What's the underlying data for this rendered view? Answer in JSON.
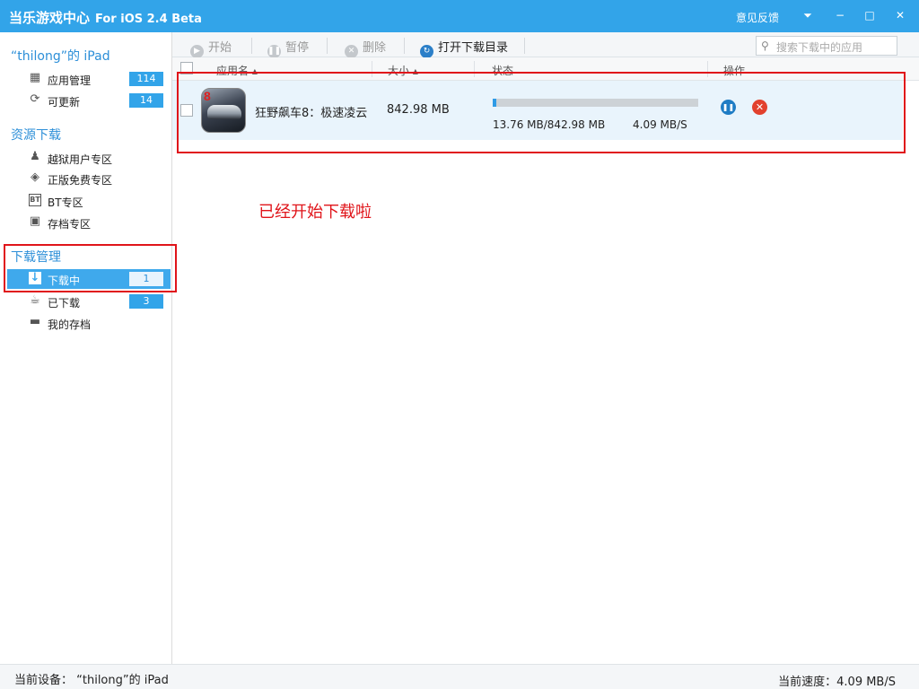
{
  "window": {
    "title": "当乐游戏中心",
    "version": "For iOS 2.4 Beta",
    "feedback": "意见反馈",
    "controls": {
      "menu": "⏷",
      "minimize": "−",
      "maximize": "□",
      "close": "✕"
    }
  },
  "sidebar": {
    "device_title": "“thilong”的 iPad",
    "device_items": [
      {
        "label": "应用管理",
        "count": "114",
        "icon": "grid-icon"
      },
      {
        "label": "可更新",
        "count": "14",
        "icon": "refresh-icon"
      }
    ],
    "resources_title": "资源下载",
    "resource_items": [
      {
        "label": "越狱用户专区",
        "icon": "jailbreak-icon"
      },
      {
        "label": "正版免费专区",
        "icon": "diamond-icon"
      },
      {
        "label": "BT专区",
        "icon": "bt-icon"
      },
      {
        "label": "存档专区",
        "icon": "save-icon"
      }
    ],
    "download_title": "下载管理",
    "download_items": [
      {
        "label": "下载中",
        "count": "1",
        "icon": "download-icon",
        "active": true
      },
      {
        "label": "已下载",
        "count": "3",
        "icon": "cup-icon"
      },
      {
        "label": "我的存档",
        "icon": "folder-icon"
      }
    ]
  },
  "toolbar": {
    "start": "开始",
    "pause": "暂停",
    "delete": "删除",
    "open_dir": "打开下载目录",
    "search_placeholder": "搜索下载中的应用"
  },
  "columns": {
    "name": "应用名",
    "size": "大小",
    "status": "状态",
    "action": "操作"
  },
  "downloads": [
    {
      "name": "狂野飙车8：极速凌云",
      "size": "842.98 MB",
      "progress_text": "13.76 MB/842.98 MB",
      "speed": "4.09 MB/S",
      "progress_fraction": 0.0163
    }
  ],
  "annotation": "已经开始下载啦",
  "statusbar": {
    "device": "当前设备：  “thilong”的 iPad",
    "speed": "当前速度：4.09 MB/S"
  },
  "colors": {
    "titlebar": "#32a4e9",
    "accent": "#2d8fd8",
    "annotation_red": "#e0141a",
    "row_highlight": "#e9f4fc"
  }
}
